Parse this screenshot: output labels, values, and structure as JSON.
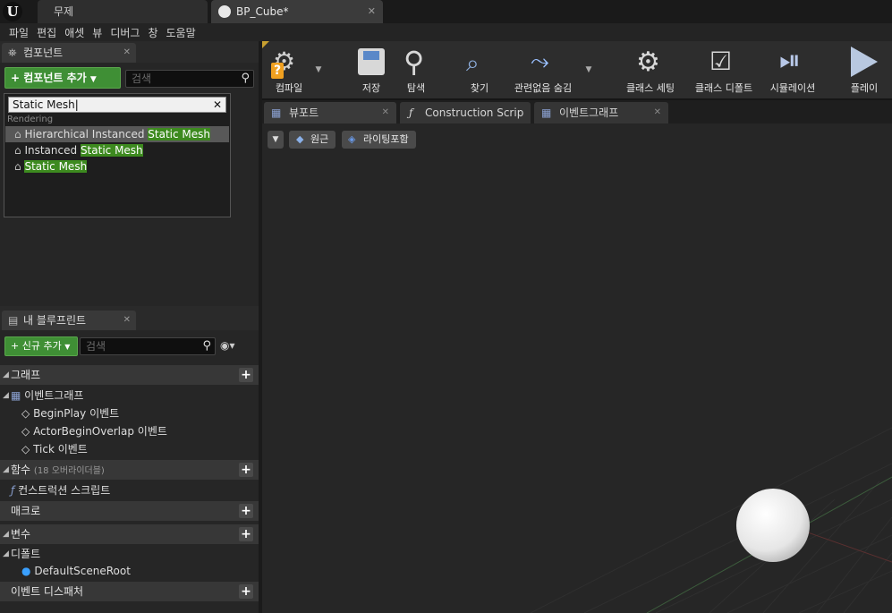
{
  "tabs": [
    {
      "label": "무제"
    },
    {
      "label": "BP_Cube*"
    }
  ],
  "menu": [
    "파일",
    "편집",
    "애셋",
    "뷰",
    "디버그",
    "창",
    "도움말"
  ],
  "components": {
    "tab": "컴포넌트",
    "add_button": "컴포넌트 추가",
    "search_placeholder": "검색",
    "dropdown_search": "Static Mesh",
    "category": "Rendering",
    "results": [
      {
        "prefix": "Hierarchical Instanced ",
        "match": "Static Mesh"
      },
      {
        "prefix": "Instanced ",
        "match": "Static Mesh"
      },
      {
        "prefix": "",
        "match": "Static Mesh"
      }
    ]
  },
  "blueprint": {
    "tab": "내 블루프린트",
    "new_button": "신규 추가",
    "search_placeholder": "검색",
    "graph": "그래프",
    "event_graph": "이벤트그래프",
    "events": [
      "BeginPlay 이벤트",
      "ActorBeginOverlap 이벤트",
      "Tick 이벤트"
    ],
    "functions": "함수",
    "functions_note": "(18 오버라이더블)",
    "construction_script": "컨스트럭션 스크립트",
    "macros": "매크로",
    "variables": "변수",
    "defaults": "디폴트",
    "default_root": "DefaultSceneRoot",
    "dispatchers": "이벤트 디스패처"
  },
  "toolbar": {
    "compile": "컴파일",
    "save": "저장",
    "browse": "탐색",
    "find": "찾기",
    "hide_unrelated": "관련없음 숨김",
    "class_settings": "클래스 세팅",
    "class_defaults": "클래스 디폴트",
    "simulation": "시뮬레이션",
    "play": "플레이"
  },
  "view_tabs": [
    "뷰포트",
    "Construction Scrip",
    "이벤트그래프"
  ],
  "viewport": {
    "perspective": "원근",
    "lighting": "라이팅포함"
  },
  "colors": {
    "accent_green": "#3f8f35",
    "highlight": "#3d8a1f",
    "background": "#262626"
  }
}
